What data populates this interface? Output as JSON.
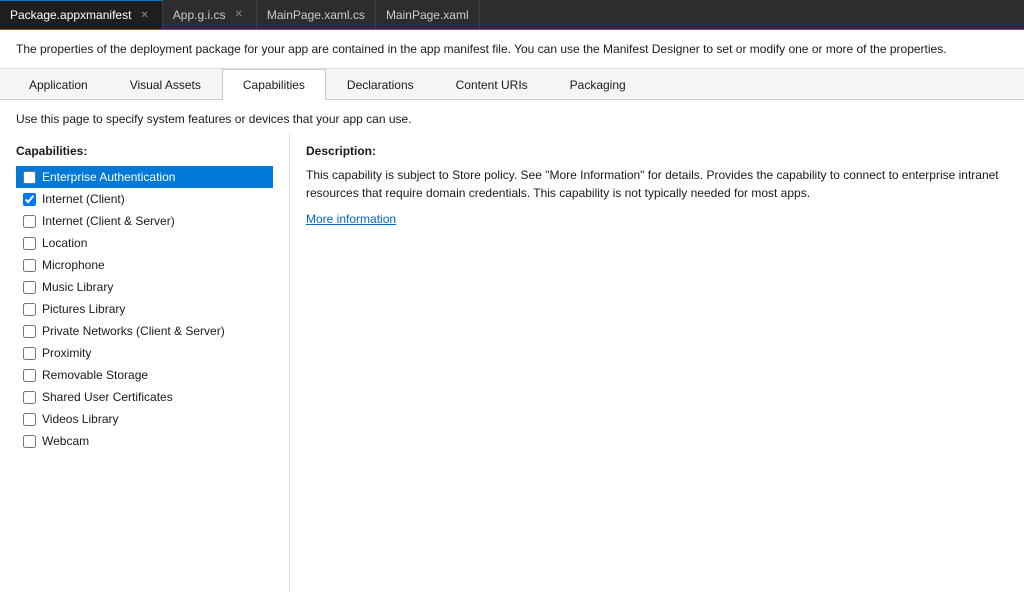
{
  "tabs": [
    {
      "id": "package-manifest",
      "label": "Package.appxmanifest",
      "active": true,
      "closable": true
    },
    {
      "id": "app-gi-cs",
      "label": "App.g.i.cs",
      "active": false,
      "closable": true
    },
    {
      "id": "mainpage-xaml-cs",
      "label": "MainPage.xaml.cs",
      "active": false,
      "closable": false
    },
    {
      "id": "mainpage-xaml",
      "label": "MainPage.xaml",
      "active": false,
      "closable": false
    }
  ],
  "info_bar": {
    "text": "The properties of the deployment package for your app are contained in the app manifest file. You can use the Manifest Designer to set or modify one or more of the properties."
  },
  "nav_tabs": [
    {
      "id": "application",
      "label": "Application",
      "active": false
    },
    {
      "id": "visual-assets",
      "label": "Visual Assets",
      "active": false
    },
    {
      "id": "capabilities",
      "label": "Capabilities",
      "active": true
    },
    {
      "id": "declarations",
      "label": "Declarations",
      "active": false
    },
    {
      "id": "content-uris",
      "label": "Content URIs",
      "active": false
    },
    {
      "id": "packaging",
      "label": "Packaging",
      "active": false
    }
  ],
  "page_desc": "Use this page to specify system features or devices that your app can use.",
  "capabilities_title": "Capabilities:",
  "description_title": "Description:",
  "capabilities": [
    {
      "id": "enterprise-auth",
      "label": "Enterprise Authentication",
      "checked": false,
      "selected": true
    },
    {
      "id": "internet-client",
      "label": "Internet (Client)",
      "checked": true,
      "selected": false
    },
    {
      "id": "internet-client-server",
      "label": "Internet (Client & Server)",
      "checked": false,
      "selected": false
    },
    {
      "id": "location",
      "label": "Location",
      "checked": false,
      "selected": false
    },
    {
      "id": "microphone",
      "label": "Microphone",
      "checked": false,
      "selected": false
    },
    {
      "id": "music-library",
      "label": "Music Library",
      "checked": false,
      "selected": false
    },
    {
      "id": "pictures-library",
      "label": "Pictures Library",
      "checked": false,
      "selected": false
    },
    {
      "id": "private-networks",
      "label": "Private Networks (Client & Server)",
      "checked": false,
      "selected": false
    },
    {
      "id": "proximity",
      "label": "Proximity",
      "checked": false,
      "selected": false
    },
    {
      "id": "removable-storage",
      "label": "Removable Storage",
      "checked": false,
      "selected": false
    },
    {
      "id": "shared-user-certs",
      "label": "Shared User Certificates",
      "checked": false,
      "selected": false
    },
    {
      "id": "videos-library",
      "label": "Videos Library",
      "checked": false,
      "selected": false
    },
    {
      "id": "webcam",
      "label": "Webcam",
      "checked": false,
      "selected": false
    }
  ],
  "description": {
    "text": "This capability is subject to Store policy. See \"More Information\" for details. Provides the capability to connect to enterprise intranet resources that require domain credentials. This capability is not typically needed for most apps.",
    "more_info_label": "More information"
  }
}
